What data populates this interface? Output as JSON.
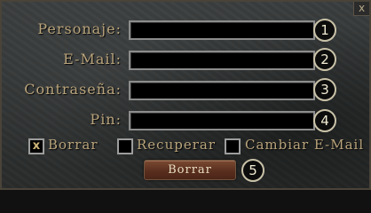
{
  "dialog": {
    "close_label": "x"
  },
  "fields": [
    {
      "label": "Personaje:",
      "value": "",
      "step": "1"
    },
    {
      "label": "E-Mail:",
      "value": "",
      "step": "2"
    },
    {
      "label": "Contraseña:",
      "value": "",
      "step": "3"
    },
    {
      "label": "Pin:",
      "value": "",
      "step": "4"
    }
  ],
  "options": [
    {
      "label": "Borrar",
      "checked": true,
      "mark": "x"
    },
    {
      "label": "Recuperar",
      "checked": false,
      "mark": ""
    },
    {
      "label": "Cambiar E-Mail",
      "checked": false,
      "mark": ""
    }
  ],
  "action": {
    "label": "Borrar",
    "step": "5"
  },
  "colors": {
    "label_text": "#b9a47c",
    "field_bg": "#000000",
    "button_bg": "#6a3b28"
  },
  "icons": {
    "close": "close-icon",
    "check": "checkmark-icon"
  }
}
